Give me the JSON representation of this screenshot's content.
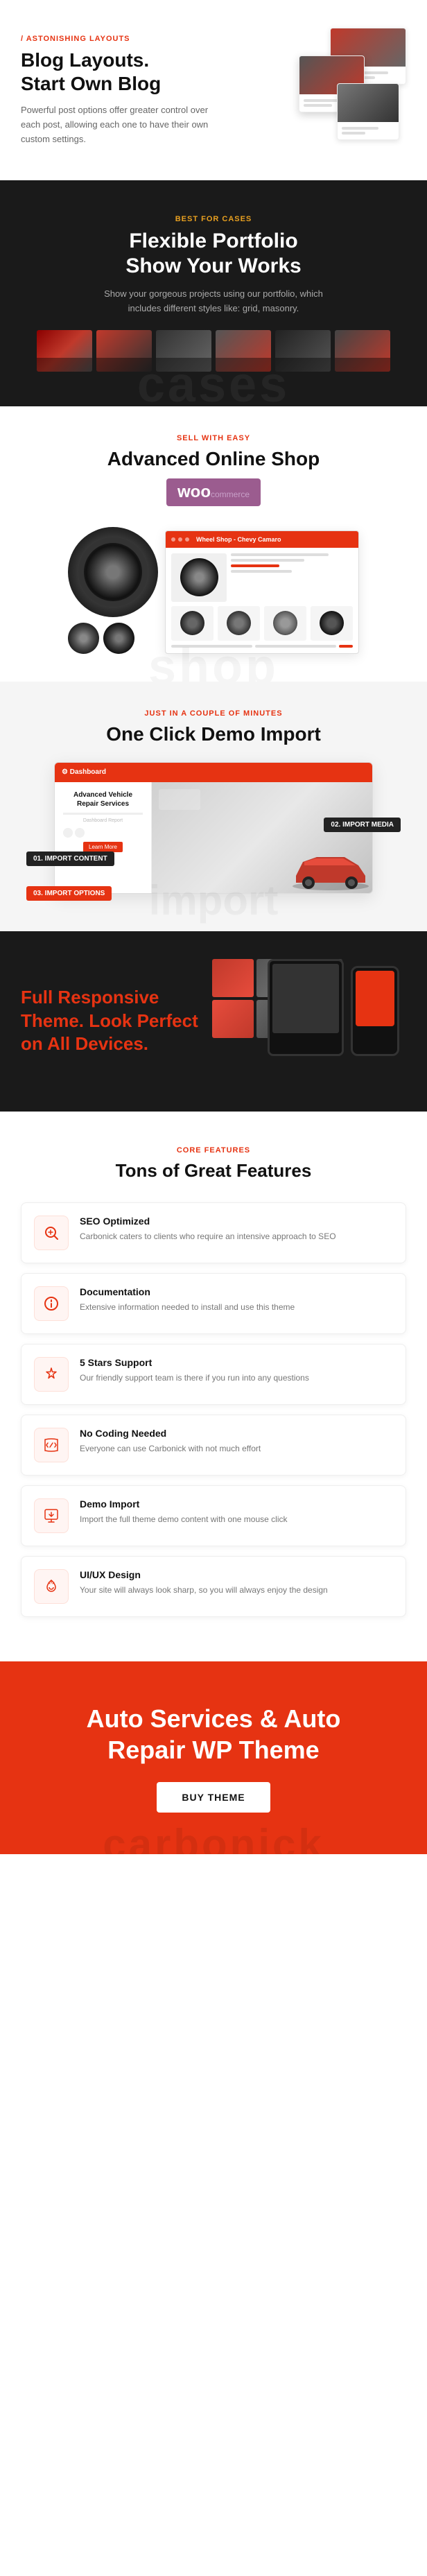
{
  "section_blog": {
    "label": "/ ASTONISHING LAYOUTS",
    "title_line1": "Blog Layouts.",
    "title_line2": "Start Own Blog",
    "description": "Powerful post options offer greater control over each post, allowing each one to have their own custom settings."
  },
  "section_portfolio": {
    "label": "BEST FOR CASES",
    "title_line1": "Flexible Portfolio",
    "title_line2": "Show Your Works",
    "description": "Show your gorgeous projects using our portfolio, which includes different styles like: grid, masonry.",
    "watermark": "cases"
  },
  "section_shop": {
    "label": "SELL WITH EASY",
    "title": "Advanced Online Shop",
    "woo_label": "woo",
    "watermark": "shop"
  },
  "section_demo_import": {
    "label": "JUST IN A COUPLE OF MINUTES",
    "title": "One Click Demo Import",
    "badge_01": "01. IMPORT CONTENT",
    "badge_02": "02. IMPORT MEDIA",
    "badge_03": "03. IMPORT OPTIONS",
    "laptop_heading": "Advanced Vehicle Repair Services",
    "laptop_subtext": ""
  },
  "section_responsive": {
    "title_line1": "Full Responsive",
    "title_line2": "Theme. Look Perfect",
    "title_line3_normal": "on ",
    "title_line3_accent": "All Devices."
  },
  "section_features": {
    "label": "CORE FEATURES",
    "title": "Tons of Great Features",
    "features": [
      {
        "icon": "🔍",
        "title": "SEO Optimized",
        "description": "Carbonick caters to clients who require an intensive approach to SEO"
      },
      {
        "icon": "📖",
        "title": "Documentation",
        "description": "Extensive information needed to install and use this theme"
      },
      {
        "icon": "⭐",
        "title": "5 Stars Support",
        "description": "Our friendly support team is there if you run into any questions"
      },
      {
        "icon": "💻",
        "title": "No Coding Needed",
        "description": "Everyone can use Carbonick with not much effort"
      },
      {
        "icon": "⬇️",
        "title": "Demo Import",
        "description": "Import the full theme demo content with one mouse click"
      },
      {
        "icon": "🎨",
        "title": "UI/UX Design",
        "description": "Your site will always look sharp, so you will always enjoy the design"
      }
    ]
  },
  "section_cta": {
    "title_line1": "Auto Services & Auto",
    "title_line2": "Repair WP Theme",
    "button_label": "BUY THEME",
    "watermark": "carbonick"
  }
}
